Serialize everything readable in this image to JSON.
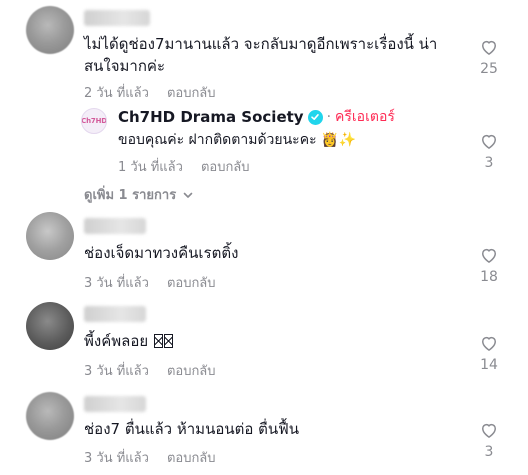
{
  "comments": [
    {
      "text": "ไม่ได้ดูช่อง7มานานแล้ว จะกลับมาดูอีกเพราะเรื่องนี้ น่าสนใจมากค่ะ",
      "time": "2 วัน ที่แล้ว",
      "reply": "ตอบกลับ",
      "likes": "25"
    },
    {
      "text": "ช่องเจ็ดมาทวงคืนเรตติ้ง",
      "time": "3 วัน ที่แล้ว",
      "reply": "ตอบกลับ",
      "likes": "18"
    },
    {
      "text": "พี้งค์พลอย",
      "time": "3 วัน ที่แล้ว",
      "reply": "ตอบกลับ",
      "likes": "14"
    },
    {
      "text": "ช่อง7 ตื่นแล้ว ห้ามนอนต่อ ตื่นฟื้น",
      "time": "3 วัน ที่แล้ว",
      "reply": "ตอบกลับ",
      "likes": "3"
    }
  ],
  "creator_reply": {
    "author": "Ch7HD Drama Society",
    "separator": "·",
    "badge": "ครีเอเตอร์",
    "text": "ขอบคุณค่ะ ฝากติดตามด้วยนะคะ",
    "emoji": "👸✨",
    "time": "1 วัน ที่แล้ว",
    "reply": "ตอบกลับ",
    "likes": "3",
    "avatar_logo": "Ch7HD"
  },
  "view_more": "ดูเพิ่ม 1 รายการ",
  "colors": {
    "accent_red": "#fe2c55",
    "verified": "#20d5ec",
    "muted": "#8a8b91"
  },
  "icons": {
    "like": "heart-outline-icon",
    "chevron": "chevron-down-icon",
    "verified": "checkmark-badge-icon"
  }
}
